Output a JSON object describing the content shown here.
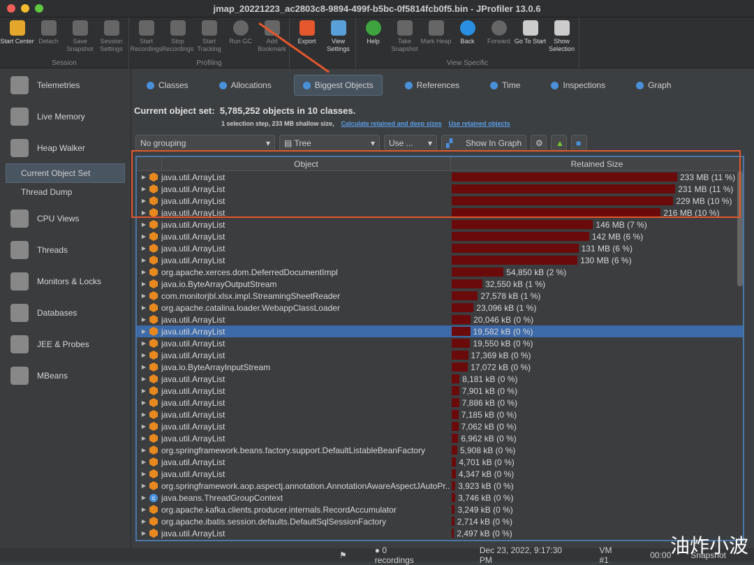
{
  "window": {
    "title": "jmap_20221223_ac2803c8-9894-499f-b5bc-0f5814fcb0f5.bin - JProfiler 13.0.6"
  },
  "toolbar": {
    "groups": [
      {
        "label": "Session",
        "buttons": [
          {
            "label": "Start Center",
            "enabled": true,
            "icon": "folder-play-icon"
          },
          {
            "label": "Detach",
            "enabled": false,
            "icon": "detach-icon"
          },
          {
            "label": "Save Snapshot",
            "enabled": false,
            "icon": "save-icon"
          },
          {
            "label": "Session Settings",
            "enabled": false,
            "icon": "settings-icon"
          }
        ]
      },
      {
        "label": "Profiling",
        "buttons": [
          {
            "label": "Start Recordings",
            "enabled": false,
            "icon": "record-icon"
          },
          {
            "label": "Stop Recordings",
            "enabled": false,
            "icon": "stop-icon"
          },
          {
            "label": "Start Tracking",
            "enabled": false,
            "icon": "tracking-icon"
          },
          {
            "label": "Run GC",
            "enabled": false,
            "icon": "gc-icon"
          },
          {
            "label": "Add Bookmark",
            "enabled": false,
            "icon": "bookmark-icon"
          }
        ]
      },
      {
        "label": "",
        "buttons": [
          {
            "label": "Export",
            "enabled": true,
            "icon": "export-icon"
          },
          {
            "label": "View Settings",
            "enabled": true,
            "icon": "view-settings-icon"
          }
        ]
      },
      {
        "label": "View Specific",
        "buttons": [
          {
            "label": "Help",
            "enabled": true,
            "icon": "help-icon"
          },
          {
            "label": "Take Snapshot",
            "enabled": false,
            "icon": "camera-icon"
          },
          {
            "label": "Mark Heap",
            "enabled": false,
            "icon": "pin-icon"
          },
          {
            "label": "Back",
            "enabled": true,
            "icon": "back-icon"
          },
          {
            "label": "Forward",
            "enabled": false,
            "icon": "forward-icon"
          },
          {
            "label": "Go To Start",
            "enabled": true,
            "icon": "home-icon"
          },
          {
            "label": "Show Selection",
            "enabled": true,
            "icon": "show-selection-icon"
          }
        ]
      }
    ]
  },
  "sidebar": {
    "items": [
      {
        "label": "Telemetries"
      },
      {
        "label": "Live Memory"
      },
      {
        "label": "Heap Walker",
        "subitems": [
          {
            "label": "Current Object Set",
            "selected": true
          },
          {
            "label": "Thread Dump",
            "selected": false
          }
        ]
      },
      {
        "label": "CPU Views"
      },
      {
        "label": "Threads"
      },
      {
        "label": "Monitors & Locks"
      },
      {
        "label": "Databases"
      },
      {
        "label": "JEE & Probes"
      },
      {
        "label": "MBeans"
      }
    ]
  },
  "tabs": [
    {
      "label": "Classes"
    },
    {
      "label": "Allocations"
    },
    {
      "label": "Biggest Objects",
      "selected": true
    },
    {
      "label": "References"
    },
    {
      "label": "Time"
    },
    {
      "label": "Inspections"
    },
    {
      "label": "Graph"
    }
  ],
  "info": {
    "label": "Current object set:",
    "summary": "5,785,252 objects in 10 classes.",
    "detail": "1 selection step, 233 MB shallow size,",
    "link1": "Calculate retained and deep sizes",
    "link2": "Use retained objects"
  },
  "controls": {
    "grouping": "No grouping",
    "view": "Tree",
    "use": "Use ...",
    "show_graph": "Show In Graph"
  },
  "table": {
    "columns": [
      "Object",
      "Retained Size"
    ],
    "max_kb": 238592,
    "rows": [
      [
        "java.util.ArrayList",
        "233 MB (11 %)",
        238592
      ],
      [
        "java.util.ArrayList",
        "231 MB (11 %)",
        236544
      ],
      [
        "java.util.ArrayList",
        "229 MB (10 %)",
        234496
      ],
      [
        "java.util.ArrayList",
        "216 MB (10 %)",
        221184
      ],
      [
        "java.util.ArrayList",
        "146 MB (7 %)",
        149504
      ],
      [
        "java.util.ArrayList",
        "142 MB (6 %)",
        145408
      ],
      [
        "java.util.ArrayList",
        "131 MB (6 %)",
        134144
      ],
      [
        "java.util.ArrayList",
        "130 MB (6 %)",
        133120
      ],
      [
        "org.apache.xerces.dom.DeferredDocumentImpl",
        "54,850 kB (2 %)",
        54850
      ],
      [
        "java.io.ByteArrayOutputStream",
        "32,550 kB (1 %)",
        32550
      ],
      [
        "com.monitorjbl.xlsx.impl.StreamingSheetReader",
        "27,578 kB (1 %)",
        27578
      ],
      [
        "org.apache.catalina.loader.WebappClassLoader",
        "23,096 kB (1 %)",
        23096
      ],
      [
        "java.util.ArrayList",
        "20,046 kB (0 %)",
        20046
      ],
      [
        "java.util.ArrayList",
        "19,582 kB (0 %)",
        19582
      ],
      [
        "java.util.ArrayList",
        "19,550 kB (0 %)",
        19550
      ],
      [
        "java.util.ArrayList",
        "17,369 kB (0 %)",
        17369
      ],
      [
        "java.io.ByteArrayInputStream",
        "17,072 kB (0 %)",
        17072
      ],
      [
        "java.util.ArrayList",
        "8,181 kB (0 %)",
        8181
      ],
      [
        "java.util.ArrayList",
        "7,901 kB (0 %)",
        7901
      ],
      [
        "java.util.ArrayList",
        "7,886 kB (0 %)",
        7886
      ],
      [
        "java.util.ArrayList",
        "7,185 kB (0 %)",
        7185
      ],
      [
        "java.util.ArrayList",
        "7,062 kB (0 %)",
        7062
      ],
      [
        "java.util.ArrayList",
        "6,962 kB (0 %)",
        6962
      ],
      [
        "org.springframework.beans.factory.support.DefaultListableBeanFactory",
        "5,908 kB (0 %)",
        5908
      ],
      [
        "java.util.ArrayList",
        "4,701 kB (0 %)",
        4701
      ],
      [
        "java.util.ArrayList",
        "4,347 kB (0 %)",
        4347
      ],
      [
        "org.springframework.aop.aspectj.annotation.AnnotationAwareAspectJAutoPr...",
        "3,923 kB (0 %)",
        3923
      ],
      [
        "java.beans.ThreadGroupContext",
        "3,746 kB (0 %)",
        3746
      ],
      [
        "org.apache.kafka.clients.producer.internals.RecordAccumulator",
        "3,249 kB (0 %)",
        3249
      ],
      [
        "org.apache.ibatis.session.defaults.DefaultSqlSessionFactory",
        "2,714 kB (0 %)",
        2714
      ],
      [
        "java.util.ArrayList",
        "2,497 kB (0 %)",
        2497
      ]
    ],
    "selected_row": 13,
    "class_icon_rows": [
      27
    ]
  },
  "status": {
    "recordings": "0 recordings",
    "datetime": "Dec 23, 2022, 9:17:30 PM",
    "vm": "VM #1",
    "time": "00:00",
    "mode": "Snapshot"
  },
  "watermark": "油炸小波",
  "colors": {
    "bar": "#6b0a0a",
    "selection": "#3d6aa8",
    "highlight_box": "#e5572c",
    "table_border": "#4a77a8"
  }
}
